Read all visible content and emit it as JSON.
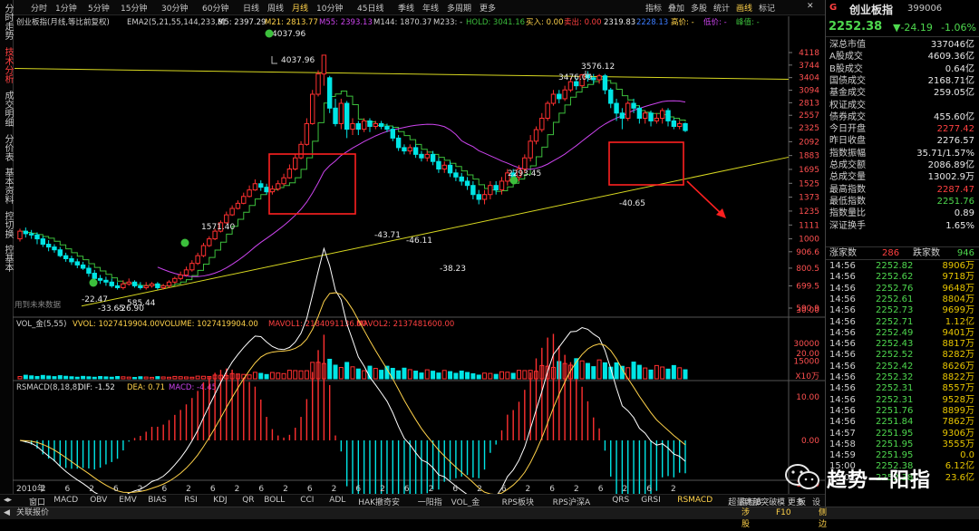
{
  "toolbar": {
    "periods": [
      "分时",
      "1分钟",
      "5分钟",
      "15分钟",
      "30分钟",
      "60分钟",
      "日线",
      "周线",
      "月线",
      "10分钟",
      "45日线",
      "季线",
      "年线",
      "多周期",
      "更多"
    ],
    "active_period": "月线",
    "right_items": [
      "指标",
      "叠加",
      "多股",
      "统计",
      "画线",
      "标记"
    ],
    "active_right": "画线"
  },
  "left_tabs": [
    {
      "label": "分时走势",
      "active": false
    },
    {
      "label": "技术分析",
      "active": true
    },
    {
      "label": "成交明细",
      "active": false
    },
    {
      "label": "分价表",
      "active": false
    },
    {
      "label": "基本资料",
      "active": false
    },
    {
      "label": "控切换",
      "active": false
    },
    {
      "label": "控基本",
      "active": false
    }
  ],
  "main_legend": {
    "name": "创业板指(月线,等比前复权)",
    "ema": "EMA2(5,21,55,144,233,8)",
    "m5": "M5: 2397.29",
    "m21": "M21: 2813.77",
    "m55": "M55: 2393.13",
    "m144": "M144: 1870.37",
    "m233": "M233: -",
    "hold": "HOLD: 3041.16",
    "buy": "买入: 0.00",
    "sell": "卖出: 0.00",
    "high": "高价: -",
    "low": "低价: -",
    "line": "峰值: -",
    "sub_dims": "2319.83",
    "sub_dims2": "2228.13"
  },
  "price_axis": [
    "4118",
    "3744",
    "3404",
    "3094",
    "2813",
    "2557",
    "2325",
    "2092",
    "1883",
    "1695",
    "1525",
    "1373",
    "1235",
    "1111",
    "1000",
    "906.6",
    "800.5",
    "699.5",
    "590.9"
  ],
  "annotations": [
    "4037.96",
    "4037.96",
    "3576.12",
    "3476.00",
    "2293.45",
    "1571.40",
    "-40.65",
    "-43.71",
    "-46.11",
    "-38.23",
    "-22.47",
    "-33.65",
    "-26.90",
    "585.44"
  ],
  "future_note": "用到未来数据",
  "chart_data": [
    {
      "type": "candlestick",
      "title": "创业板指(月线,等比前复权)",
      "x_axis_labels": [
        "2010年",
        "2",
        "6",
        "2",
        "6",
        "2",
        "6",
        "2",
        "6",
        "2",
        "6",
        "2",
        "6",
        "2",
        "6",
        "2",
        "6",
        "2",
        "6",
        "2",
        "6",
        "2",
        "6",
        "2",
        "6",
        "2",
        "6",
        "2"
      ],
      "ylim": [
        590.9,
        4118
      ],
      "scale": "log",
      "candles": [
        [
          1000,
          1060,
          1080,
          980
        ],
        [
          1060,
          1040,
          1090,
          1010
        ],
        [
          1040,
          1030,
          1070,
          1000
        ],
        [
          1030,
          1000,
          1050,
          960
        ],
        [
          1000,
          960,
          1020,
          940
        ],
        [
          960,
          940,
          990,
          910
        ],
        [
          940,
          920,
          960,
          900
        ],
        [
          920,
          880,
          940,
          870
        ],
        [
          880,
          860,
          900,
          840
        ],
        [
          860,
          840,
          880,
          820
        ],
        [
          840,
          820,
          860,
          800
        ],
        [
          820,
          800,
          840,
          790
        ],
        [
          800,
          770,
          820,
          750
        ],
        [
          770,
          740,
          790,
          720
        ],
        [
          740,
          730,
          760,
          710
        ],
        [
          730,
          720,
          750,
          700
        ],
        [
          720,
          700,
          740,
          690
        ],
        [
          700,
          690,
          720,
          680
        ],
        [
          690,
          710,
          730,
          680
        ],
        [
          710,
          720,
          740,
          700
        ],
        [
          720,
          700,
          730,
          690
        ],
        [
          700,
          690,
          720,
          680
        ],
        [
          690,
          700,
          720,
          680
        ],
        [
          700,
          710,
          720,
          690
        ],
        [
          710,
          690,
          720,
          680
        ],
        [
          690,
          700,
          710,
          680
        ],
        [
          700,
          720,
          730,
          690
        ],
        [
          720,
          740,
          750,
          710
        ],
        [
          740,
          760,
          780,
          730
        ],
        [
          760,
          790,
          810,
          750
        ],
        [
          790,
          830,
          850,
          780
        ],
        [
          830,
          880,
          900,
          820
        ],
        [
          880,
          950,
          970,
          870
        ],
        [
          950,
          1000,
          1020,
          940
        ],
        [
          1000,
          1060,
          1080,
          990
        ],
        [
          1060,
          1130,
          1150,
          1050
        ],
        [
          1130,
          1200,
          1230,
          1120
        ],
        [
          1200,
          1260,
          1290,
          1190
        ],
        [
          1260,
          1310,
          1340,
          1250
        ],
        [
          1310,
          1380,
          1420,
          1300
        ],
        [
          1380,
          1450,
          1500,
          1370
        ],
        [
          1450,
          1520,
          1571,
          1440
        ],
        [
          1520,
          1480,
          1560,
          1440
        ],
        [
          1480,
          1430,
          1520,
          1400
        ],
        [
          1430,
          1460,
          1500,
          1400
        ],
        [
          1460,
          1520,
          1560,
          1440
        ],
        [
          1520,
          1590,
          1640,
          1500
        ],
        [
          1590,
          1700,
          1760,
          1580
        ],
        [
          1700,
          1850,
          1900,
          1680
        ],
        [
          1850,
          2050,
          2100,
          1830
        ],
        [
          2050,
          2400,
          2500,
          2030
        ],
        [
          2400,
          3000,
          3100,
          2380
        ],
        [
          3000,
          3500,
          3600,
          2950
        ],
        [
          3500,
          4037,
          4037,
          3200
        ],
        [
          3400,
          2700,
          3450,
          2600
        ],
        [
          2700,
          2400,
          2900,
          2350
        ],
        [
          2400,
          2800,
          2900,
          2300
        ],
        [
          2800,
          2300,
          2850,
          2150
        ],
        [
          2300,
          2400,
          2500,
          2200
        ],
        [
          2400,
          2300,
          2450,
          2200
        ],
        [
          2300,
          2450,
          2500,
          2250
        ],
        [
          2450,
          2350,
          2500,
          2250
        ],
        [
          2350,
          2400,
          2450,
          2300
        ],
        [
          2400,
          2350,
          2450,
          2300
        ],
        [
          2350,
          2300,
          2400,
          2250
        ],
        [
          2300,
          2150,
          2350,
          2100
        ],
        [
          2150,
          2000,
          2200,
          1950
        ],
        [
          2000,
          1950,
          2050,
          1900
        ],
        [
          1950,
          2000,
          2050,
          1900
        ],
        [
          2000,
          1900,
          2050,
          1850
        ],
        [
          1900,
          1850,
          1950,
          1800
        ],
        [
          1850,
          1900,
          1950,
          1800
        ],
        [
          1900,
          1800,
          1950,
          1750
        ],
        [
          1800,
          1700,
          1850,
          1650
        ],
        [
          1700,
          1750,
          1800,
          1650
        ],
        [
          1750,
          1650,
          1800,
          1600
        ],
        [
          1650,
          1600,
          1700,
          1550
        ],
        [
          1600,
          1550,
          1650,
          1500
        ],
        [
          1550,
          1500,
          1600,
          1450
        ],
        [
          1500,
          1400,
          1550,
          1350
        ],
        [
          1400,
          1350,
          1450,
          1300
        ],
        [
          1350,
          1400,
          1450,
          1300
        ],
        [
          1400,
          1500,
          1550,
          1350
        ],
        [
          1500,
          1450,
          1550,
          1400
        ],
        [
          1450,
          1550,
          1600,
          1400
        ],
        [
          1550,
          1650,
          1700,
          1500
        ],
        [
          1650,
          1600,
          1700,
          1550
        ],
        [
          1600,
          1700,
          1750,
          1550
        ],
        [
          1700,
          1850,
          1900,
          1650
        ],
        [
          1850,
          2100,
          2200,
          1800
        ],
        [
          2100,
          2293,
          2350,
          2050
        ],
        [
          2293,
          2500,
          2600,
          2250
        ],
        [
          2500,
          2800,
          2850,
          2450
        ],
        [
          2800,
          3000,
          3100,
          2750
        ],
        [
          3000,
          2900,
          3100,
          2800
        ],
        [
          2900,
          3100,
          3200,
          2850
        ],
        [
          3100,
          3300,
          3400,
          3050
        ],
        [
          3300,
          3200,
          3400,
          3100
        ],
        [
          3200,
          3476,
          3500,
          3150
        ],
        [
          3476,
          3400,
          3576,
          3300
        ],
        [
          3400,
          3350,
          3500,
          3250
        ],
        [
          3350,
          3450,
          3500,
          3250
        ],
        [
          3450,
          3100,
          3500,
          3000
        ],
        [
          3100,
          2800,
          3150,
          2700
        ],
        [
          2800,
          2600,
          2900,
          2450
        ],
        [
          2600,
          2500,
          2700,
          2300
        ],
        [
          2500,
          2800,
          2850,
          2450
        ],
        [
          2800,
          2700,
          2900,
          2600
        ],
        [
          2700,
          2500,
          2750,
          2400
        ],
        [
          2500,
          2600,
          2650,
          2400
        ],
        [
          2600,
          2450,
          2650,
          2350
        ],
        [
          2450,
          2500,
          2600,
          2400
        ],
        [
          2500,
          2650,
          2700,
          2400
        ],
        [
          2650,
          2450,
          2700,
          2350
        ],
        [
          2450,
          2350,
          2500,
          2300
        ],
        [
          2350,
          2400,
          2450,
          2300
        ],
        [
          2400,
          2277,
          2420,
          2251
        ]
      ],
      "ma_lines": [
        {
          "name": "M21",
          "color": "#3cbf3c"
        },
        {
          "name": "M55",
          "color": "#cc44ee"
        }
      ]
    },
    {
      "type": "bar",
      "title": "VOL_金(5,55)",
      "legend": [
        "VVOL: 1027419904.00",
        "VOLUME: 1027419904.00",
        "MAVOL1: 2184091136.00",
        "MAVOL2: 2137481600.00"
      ],
      "ylim": [
        0,
        40000
      ],
      "yticks": [
        "30000",
        "15000"
      ],
      "unit": "X10万"
    },
    {
      "type": "bar",
      "title": "RSMACD(8,18,8)",
      "legend": [
        "DIF: -1.52",
        "DEA: 0.71",
        "MACD: -4.45"
      ],
      "yticks": [
        "30.00",
        "20.00",
        "10.00",
        "0.00",
        "-10.00"
      ]
    }
  ],
  "right_panel": {
    "logo": "G",
    "name": "创业板指",
    "code": "399006",
    "price": "2252.38",
    "change": "▼-24.19",
    "pct": "-1.06%",
    "rows": [
      {
        "label": "深总市值",
        "value": "337046亿",
        "color": "#e8e8e8"
      },
      {
        "label": "A股成交",
        "value": "4609.36亿",
        "color": "#e8e8e8"
      },
      {
        "label": "B股成交",
        "value": "0.64亿",
        "color": "#e8e8e8"
      },
      {
        "label": "国债成交",
        "value": "2168.71亿",
        "color": "#e8e8e8"
      },
      {
        "label": "基金成交",
        "value": "259.05亿",
        "color": "#e8e8e8"
      },
      {
        "label": "权证成交",
        "value": "",
        "color": "#e8e8e8"
      },
      {
        "label": "债券成交",
        "value": "455.60亿",
        "color": "#e8e8e8"
      },
      {
        "label": "今日开盘",
        "value": "2277.42",
        "color": "#ff4040"
      },
      {
        "label": "昨日收盘",
        "value": "2276.57",
        "color": "#e8e8e8"
      },
      {
        "label": "指数振幅",
        "value": "35.71/1.57%",
        "color": "#e8e8e8"
      },
      {
        "label": "总成交额",
        "value": "2086.89亿",
        "color": "#e8e8e8"
      },
      {
        "label": "总成交量",
        "value": "13002.9万",
        "color": "#e8e8e8"
      },
      {
        "label": "最高指数",
        "value": "2287.47",
        "color": "#ff4040"
      },
      {
        "label": "最低指数",
        "value": "2251.76",
        "color": "#4ed84e"
      },
      {
        "label": "指数量比",
        "value": "0.89",
        "color": "#e8e8e8"
      },
      {
        "label": "深证换手",
        "value": "1.65%",
        "color": "#e8e8e8"
      }
    ],
    "updown": {
      "up_label": "涨家数",
      "up": "286",
      "down_label": "跌家数",
      "down": "946"
    },
    "ticks": [
      {
        "t": "14:56",
        "p": "2252.82",
        "v": "8906万"
      },
      {
        "t": "14:56",
        "p": "2252.62",
        "v": "9718万"
      },
      {
        "t": "14:56",
        "p": "2252.76",
        "v": "9648万"
      },
      {
        "t": "14:56",
        "p": "2252.61",
        "v": "8804万"
      },
      {
        "t": "14:56",
        "p": "2252.73",
        "v": "9699万"
      },
      {
        "t": "14:56",
        "p": "2252.71",
        "v": "1.12亿"
      },
      {
        "t": "14:56",
        "p": "2252.49",
        "v": "9401万"
      },
      {
        "t": "14:56",
        "p": "2252.43",
        "v": "8817万"
      },
      {
        "t": "14:56",
        "p": "2252.52",
        "v": "8282万"
      },
      {
        "t": "14:56",
        "p": "2252.42",
        "v": "8626万"
      },
      {
        "t": "14:56",
        "p": "2252.32",
        "v": "8822万"
      },
      {
        "t": "14:56",
        "p": "2252.31",
        "v": "8557万"
      },
      {
        "t": "14:56",
        "p": "2252.31",
        "v": "9528万"
      },
      {
        "t": "14:56",
        "p": "2251.76",
        "v": "8899万"
      },
      {
        "t": "14:56",
        "p": "2251.84",
        "v": "7862万"
      },
      {
        "t": "14:57",
        "p": "2251.95",
        "v": "9306万"
      },
      {
        "t": "14:58",
        "p": "2251.95",
        "v": "3555万"
      },
      {
        "t": "14:59",
        "p": "2251.95",
        "v": "0.0"
      },
      {
        "t": "15:00",
        "p": "2252.38",
        "v": "6.12亿"
      },
      {
        "t": "15:01",
        "p": "2252.38",
        "v": "23.6亿"
      }
    ]
  },
  "bottom_tabs": [
    "窗口",
    "MACD",
    "OBV",
    "EMV",
    "BIAS",
    "RSI",
    "KDJ",
    "QR",
    "BOLL",
    "CCI",
    "ADL",
    "HAK撤奇安",
    "一阳指",
    "VOL_金",
    "RPS板块",
    "RPS沪深A",
    "QRS",
    "GRSI",
    "RSMACD",
    "超量庞部突破",
    "更多",
    "设置"
  ],
  "active_bottom_tab": "RSMACD",
  "bottom_right": [
    "指标B",
    "模",
    "板"
  ],
  "status": {
    "left": "关联报价",
    "right_items": [
      "涉股",
      "F10",
      "侧边"
    ]
  },
  "watermark": {
    "text": "趋势一阳指"
  },
  "colors": {
    "up": "#ff3030",
    "down": "#00e5e5",
    "ma21": "#3cbf3c",
    "ma55": "#cc44ee",
    "trend": "#d8d820",
    "box": "#ff2020"
  }
}
